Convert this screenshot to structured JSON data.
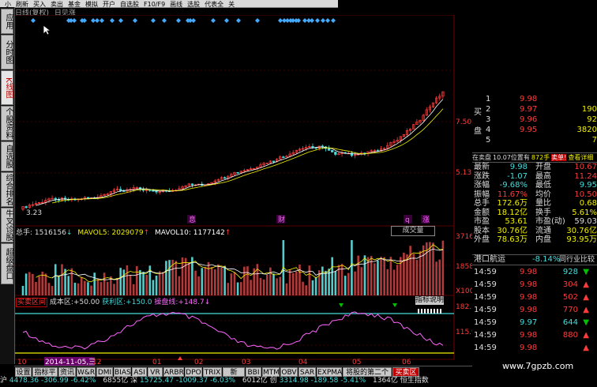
{
  "toolbar": {
    "items": [
      "小",
      "刷新",
      "买入",
      "卖出",
      "基金",
      "模拟",
      "开户",
      "自选股",
      "F10/F9",
      "画线",
      "选股",
      "代表全",
      "关"
    ]
  },
  "left_nav": [
    {
      "label": "应用",
      "active": false
    },
    {
      "label": "分时图",
      "active": false
    },
    {
      "label": "K线图",
      "active": true
    },
    {
      "label": "个股资料",
      "active": false
    },
    {
      "label": "自选股",
      "active": false
    },
    {
      "label": "综合排名",
      "active": false
    },
    {
      "label": "牛叉诊股",
      "active": false
    },
    {
      "label": "超级盘口",
      "active": false
    }
  ],
  "chart_header": {
    "period": "日线(复权)",
    "index": "日见涨"
  },
  "price_panel": {
    "y_labels": [
      "7.50",
      "5.13"
    ],
    "low_label": "3.23",
    "markers": [
      "息",
      "财",
      "q",
      "涨"
    ]
  },
  "volume_panel": {
    "total": "总手: 1516156",
    "mavol5": "MAVOL5: 2029079",
    "mavol10": "MAVOL10: 1177142",
    "tab_label": "成交量",
    "y_labels": [
      "37164",
      "18582",
      "X100"
    ]
  },
  "indicator_panel": {
    "name": "买卖区间",
    "cost_label": "成本区:",
    "cost_value": "+50.00",
    "profit_label": "获利区:",
    "profit_value": "+150.0",
    "control_label": "操盘线:",
    "control_value": "+148.7",
    "help_label": "指标说明",
    "y_labels": [
      "182.5",
      "115.9"
    ]
  },
  "x_axis": {
    "labels": [
      "10",
      "2014-11-05,三",
      "12",
      "01",
      "02",
      "03",
      "04",
      "05",
      "06"
    ]
  },
  "bottom_tabs": [
    "设置",
    "指标平台",
    "资讯",
    "W&R",
    "DMI",
    "BIAS",
    "ASI",
    "VR",
    "ARBR",
    "DPO",
    "TRIX",
    "新DMA",
    "BBI",
    "MTM",
    "OBV",
    "SAR",
    "EXPMA",
    "将股的第二个拐点P",
    "买卖区间"
  ],
  "active_bottom_tab": "买卖区间",
  "status_bar": {
    "sh_label": "沪",
    "sh_index": "4478.36",
    "sh_change": "-306.99",
    "sh_pct": "-6.42%",
    "sh_amount": "6855亿",
    "sz_label": "深",
    "sz_index": "15725.47",
    "sz_change": "-1009.37",
    "sz_pct": "-6.03%",
    "sz_amount": "6012亿",
    "cy_label": "创",
    "cy_index": "3314.98",
    "cy_change": "-189.58",
    "cy_pct": "-5.41%",
    "cy_amount": "1364亿",
    "hk_label": "恒生指数"
  },
  "quote": {
    "buy_label": "买",
    "pan_label": "盘",
    "bids": [
      {
        "level": "1",
        "price": "9.98",
        "vol": ""
      },
      {
        "level": "2",
        "price": "9.97",
        "vol": "190"
      },
      {
        "level": "3",
        "price": "9.96",
        "vol": "92"
      },
      {
        "level": "4",
        "price": "9.95",
        "vol": "3820"
      },
      {
        "level": "5",
        "price": "",
        "vol": "7"
      }
    ],
    "position_line": "在卖盘",
    "position_value": "10.07位置有",
    "position_hands": "872手",
    "sell_tag": "卖单!",
    "detail_link": "查看详细",
    "stats_left": [
      {
        "label": "最新",
        "value": "9.98"
      },
      {
        "label": "涨跌",
        "value": "-1.07"
      },
      {
        "label": "涨幅",
        "value": "-9.68%"
      },
      {
        "label": "振幅",
        "value": "11.67%"
      },
      {
        "label": "总手",
        "value": "172.6万"
      },
      {
        "label": "金额",
        "value": "18.12亿"
      },
      {
        "label": "市盈",
        "value": "53.61"
      },
      {
        "label": "股本",
        "value": "30.76亿"
      },
      {
        "label": "外盘",
        "value": "78.63万"
      }
    ],
    "stats_right": [
      {
        "label": "开盘",
        "value": "10.67"
      },
      {
        "label": "最高",
        "value": "11.24"
      },
      {
        "label": "最低",
        "value": "9.95"
      },
      {
        "label": "均价",
        "value": "10.50"
      },
      {
        "label": "量比",
        "value": "0.68"
      },
      {
        "label": "换手",
        "value": "5.61%"
      },
      {
        "label": "市盈(动)",
        "value": "59.03"
      },
      {
        "label": "流通",
        "value": "30.76亿"
      },
      {
        "label": "内盘",
        "value": "93.95万"
      }
    ],
    "stock_name": "港口航运",
    "stock_pct": "-8.14%",
    "compare_link": "同行业比较",
    "ticks": [
      {
        "time": "14:59",
        "price": "9.98",
        "vol": "928",
        "dir": "down"
      },
      {
        "time": "14:59",
        "price": "9.98",
        "vol": "304",
        "dir": "up"
      },
      {
        "time": "14:59",
        "price": "9.98",
        "vol": "502",
        "dir": "up"
      },
      {
        "time": "14:59",
        "price": "9.98",
        "vol": "770",
        "dir": "up"
      },
      {
        "time": "14:59",
        "price": "9.97",
        "vol": "644",
        "dir": "down"
      },
      {
        "time": "14:59",
        "price": "9.98",
        "vol": "880",
        "dir": "up"
      },
      {
        "time": "14:59",
        "price": "9.98",
        "vol": "",
        "dir": "up"
      }
    ]
  },
  "watermark": "www.7gpzb.com",
  "colors": {
    "up": "#ff3b3b",
    "down": "#44dddd",
    "grid": "#7a0000",
    "ma_white": "#ffffff",
    "ma_yellow": "#f0f000",
    "ma_purple": "#ff66ff",
    "ma_green": "#00c000",
    "accent_red": "#c00000"
  }
}
